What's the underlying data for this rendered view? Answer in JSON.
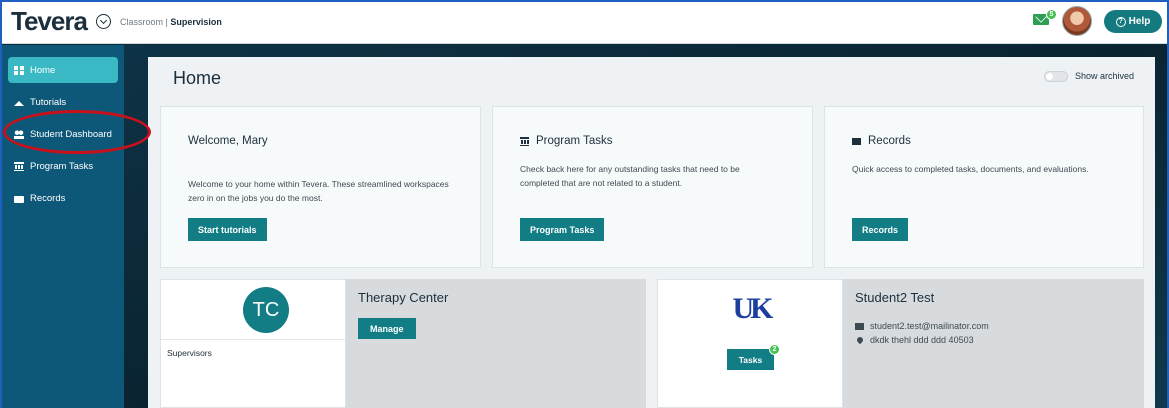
{
  "topbar": {
    "logo": "Tevera",
    "breadcrumb_prefix": "Classroom | ",
    "breadcrumb_current": "Supervision",
    "mail_count": "5",
    "help_label": "Help"
  },
  "sidebar": {
    "items": [
      {
        "label": "Home",
        "icon": "grid-icon",
        "active": true
      },
      {
        "label": "Tutorials",
        "icon": "graduation-cap-icon"
      },
      {
        "label": "Student Dashboard",
        "icon": "users-icon"
      },
      {
        "label": "Program Tasks",
        "icon": "institution-icon"
      },
      {
        "label": "Records",
        "icon": "briefcase-icon"
      }
    ]
  },
  "main": {
    "title": "Home",
    "show_archived_label": "Show archived",
    "cards": [
      {
        "title": "Welcome, Mary",
        "body": "Welcome to your home within Tevera. These streamlined workspaces zero in on the jobs you do the most.",
        "button": "Start tutorials"
      },
      {
        "title": "Program Tasks",
        "body": "Check back here for any outstanding tasks that need to be completed that are not related to a student.",
        "button": "Program Tasks"
      },
      {
        "title": "Records",
        "body": "Quick access to completed tasks, documents, and evaluations.",
        "button": "Records"
      }
    ],
    "site": {
      "initials": "TC",
      "supervisors_label": "Supervisors",
      "name": "Therapy Center",
      "button": "Manage"
    },
    "student": {
      "logo_text": "UK",
      "tasks_label": "Tasks",
      "tasks_count": "2",
      "name": "Student2 Test",
      "email": "student2.test@mailinator.com",
      "address": "dkdk thehl ddd ddd 40503"
    }
  },
  "colors": {
    "sidebar_bg": "#0d5878",
    "accent_teal": "#127d84",
    "active_item": "#3ab8c4",
    "annotation_red": "#c8111b"
  }
}
